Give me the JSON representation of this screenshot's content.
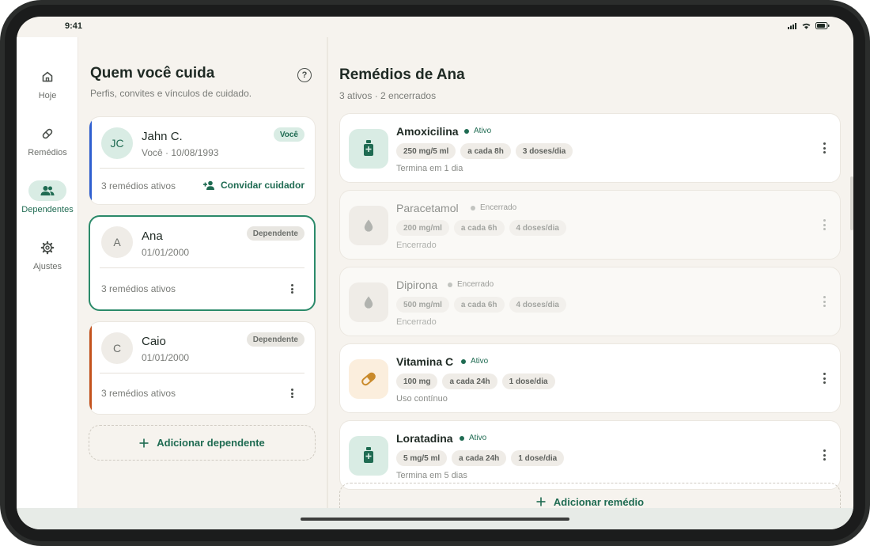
{
  "status_bar": {
    "time": "9:41"
  },
  "nav": {
    "items": [
      {
        "label": "Hoje",
        "icon": "home-icon"
      },
      {
        "label": "Remédios",
        "icon": "pill-icon"
      },
      {
        "label": "Dependentes",
        "icon": "people-icon",
        "active": true
      },
      {
        "label": "Ajustes",
        "icon": "gear-icon"
      }
    ]
  },
  "left_panel": {
    "title": "Quem você cuida",
    "subtitle": "Perfis, convites e vínculos de cuidado.",
    "people": [
      {
        "initials": "JC",
        "name": "Jahn C.",
        "meta": "Você · 10/08/1993",
        "badge": "Você",
        "count": "3 remédios ativos",
        "action": "Convidar cuidador",
        "accent": "#2f5fd0"
      },
      {
        "initials": "A",
        "name": "Ana",
        "meta": "01/01/2000",
        "badge": "Dependente",
        "count": "3 remédios ativos",
        "accent": "#2b8a6a"
      },
      {
        "initials": "C",
        "name": "Caio",
        "meta": "01/01/2000",
        "badge": "Dependente",
        "count": "3 remédios ativos",
        "accent": "#c4521d"
      }
    ],
    "add_label": "Adicionar dependente"
  },
  "right_panel": {
    "title": "Remédios de Ana",
    "subtitle": "3 ativos · 2 encerrados",
    "meds": [
      {
        "name": "Amoxicilina",
        "status": "Ativo",
        "chips": [
          "250 mg/5 ml",
          "a cada 8h",
          "3 doses/dia"
        ],
        "note": "Termina em 1 dia",
        "icon": "bottle-icon"
      },
      {
        "name": "Paracetamol",
        "status": "Encerrado",
        "chips": [
          "200 mg/ml",
          "a cada 6h",
          "4 doses/dia"
        ],
        "note": "Encerrado",
        "icon": "drop-icon"
      },
      {
        "name": "Dipirona",
        "status": "Encerrado",
        "chips": [
          "500 mg/ml",
          "a cada 6h",
          "4 doses/dia"
        ],
        "note": "Encerrado",
        "icon": "drop-icon"
      },
      {
        "name": "Vitamina C",
        "status": "Ativo",
        "chips": [
          "100 mg",
          "a cada 24h",
          "1 dose/dia"
        ],
        "note": "Uso contínuo",
        "icon": "capsule-icon"
      },
      {
        "name": "Loratadina",
        "status": "Ativo",
        "chips": [
          "5 mg/5 ml",
          "a cada 24h",
          "1 dose/dia"
        ],
        "note": "Termina em 5 dias",
        "icon": "bottle-icon"
      }
    ],
    "add_label": "Adicionar remédio"
  },
  "colors": {
    "primary": "#1f6b52",
    "primary_soft": "#d9ece4",
    "background": "#f6f3ee",
    "amber": "#c98a2b"
  }
}
